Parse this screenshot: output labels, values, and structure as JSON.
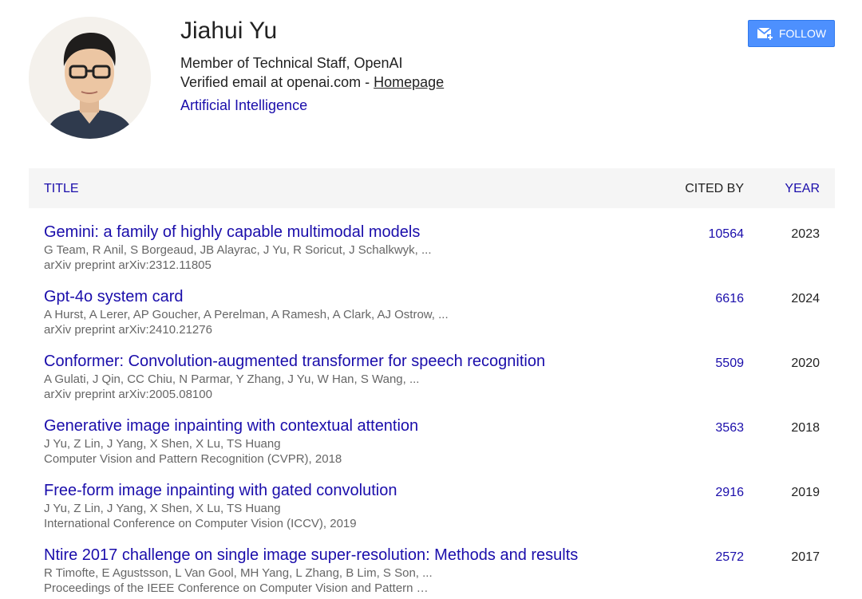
{
  "profile": {
    "name": "Jiahui Yu",
    "affiliation": "Member of Technical Staff, OpenAI",
    "email_text": "Verified email at openai.com - ",
    "homepage_label": "Homepage",
    "interest": "Artificial Intelligence",
    "follow_label": "FOLLOW",
    "follow_icon": "envelope-plus-icon"
  },
  "table": {
    "headers": {
      "title": "TITLE",
      "cited_by": "CITED BY",
      "year": "YEAR"
    },
    "rows": [
      {
        "title": "Gemini: a family of highly capable multimodal models",
        "authors": "G Team, R Anil, S Borgeaud, JB Alayrac, J Yu, R Soricut, J Schalkwyk, ...",
        "venue": "arXiv preprint arXiv:2312.11805",
        "cited_by": "10564",
        "year": "2023"
      },
      {
        "title": "Gpt-4o system card",
        "authors": "A Hurst, A Lerer, AP Goucher, A Perelman, A Ramesh, A Clark, AJ Ostrow, ...",
        "venue": "arXiv preprint arXiv:2410.21276",
        "cited_by": "6616",
        "year": "2024"
      },
      {
        "title": "Conformer: Convolution-augmented transformer for speech recognition",
        "authors": "A Gulati, J Qin, CC Chiu, N Parmar, Y Zhang, J Yu, W Han, S Wang, ...",
        "venue": "arXiv preprint arXiv:2005.08100",
        "cited_by": "5509",
        "year": "2020"
      },
      {
        "title": "Generative image inpainting with contextual attention",
        "authors": "J Yu, Z Lin, J Yang, X Shen, X Lu, TS Huang",
        "venue": "Computer Vision and Pattern Recognition (CVPR), 2018",
        "cited_by": "3563",
        "year": "2018"
      },
      {
        "title": "Free-form image inpainting with gated convolution",
        "authors": "J Yu, Z Lin, J Yang, X Shen, X Lu, TS Huang",
        "venue": "International Conference on Computer Vision (ICCV), 2019",
        "cited_by": "2916",
        "year": "2019"
      },
      {
        "title": "Ntire 2017 challenge on single image super-resolution: Methods and results",
        "authors": "R Timofte, E Agustsson, L Van Gool, MH Yang, L Zhang, B Lim, S Son, ...",
        "venue": "Proceedings of the IEEE Conference on Computer Vision and Pattern …",
        "cited_by": "2572",
        "year": "2017"
      }
    ]
  },
  "colors": {
    "link": "#1a0dab",
    "button": "#4d90fe",
    "header_bg": "#f5f5f5",
    "muted_text": "#666666"
  }
}
